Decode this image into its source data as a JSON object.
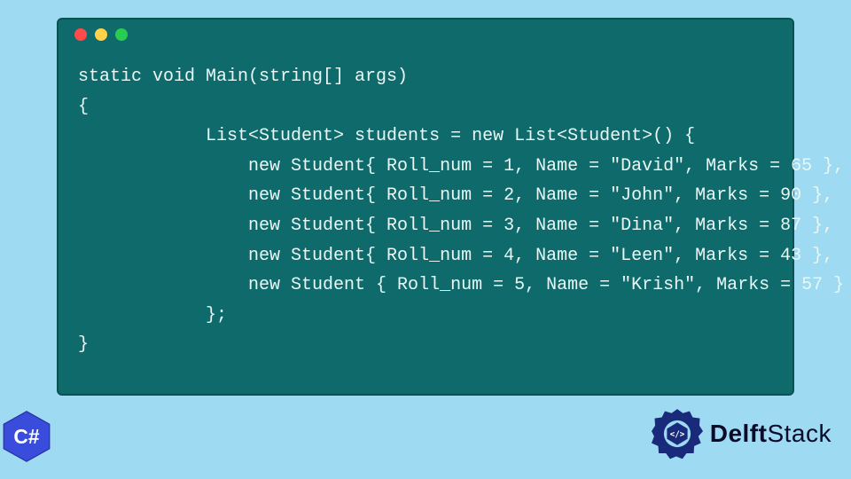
{
  "code_lines": [
    "static void Main(string[] args)",
    "{",
    "            List<Student> students = new List<Student>() {",
    "                new Student{ Roll_num = 1, Name = \"David\", Marks = 65 },",
    "                new Student{ Roll_num = 2, Name = \"John\", Marks = 90 },",
    "                new Student{ Roll_num = 3, Name = \"Dina\", Marks = 87 },",
    "                new Student{ Roll_num = 4, Name = \"Leen\", Marks = 43 },",
    "                new Student { Roll_num = 5, Name = \"Krish\", Marks = 57 }",
    "            };",
    "}"
  ],
  "badge_text": "C#",
  "brand": {
    "part1": "Delft",
    "part2": "Stack"
  },
  "colors": {
    "page_bg": "#9edaf2",
    "window_bg": "#0f6b6b",
    "code_fg": "#e9f7f6",
    "badge_bg": "#3a4cdc",
    "brand_fg": "#0a0a2a",
    "gear_fill": "#1a2a7a"
  }
}
